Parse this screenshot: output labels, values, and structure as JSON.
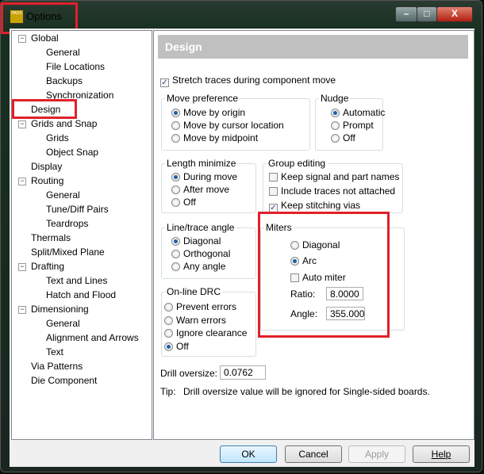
{
  "window": {
    "title": "Options",
    "icon_text": "PADS",
    "minimize": "–",
    "maximize": "□",
    "close": "X"
  },
  "tree": [
    {
      "label": "Global",
      "level": 0,
      "exp": "−"
    },
    {
      "label": "General",
      "level": 1
    },
    {
      "label": "File Locations",
      "level": 1
    },
    {
      "label": "Backups",
      "level": 1
    },
    {
      "label": "Synchronization",
      "level": 1
    },
    {
      "label": "Design",
      "level": 0,
      "selected": true
    },
    {
      "label": "Grids and Snap",
      "level": 0,
      "exp": "−"
    },
    {
      "label": "Grids",
      "level": 1
    },
    {
      "label": "Object Snap",
      "level": 1
    },
    {
      "label": "Display",
      "level": 0
    },
    {
      "label": "Routing",
      "level": 0,
      "exp": "−"
    },
    {
      "label": "General",
      "level": 1
    },
    {
      "label": "Tune/Diff Pairs",
      "level": 1
    },
    {
      "label": "Teardrops",
      "level": 1
    },
    {
      "label": "Thermals",
      "level": 0
    },
    {
      "label": "Split/Mixed Plane",
      "level": 0
    },
    {
      "label": "Drafting",
      "level": 0,
      "exp": "−"
    },
    {
      "label": "Text and Lines",
      "level": 1
    },
    {
      "label": "Hatch and Flood",
      "level": 1
    },
    {
      "label": "Dimensioning",
      "level": 0,
      "exp": "−"
    },
    {
      "label": "General",
      "level": 1
    },
    {
      "label": "Alignment and Arrows",
      "level": 1
    },
    {
      "label": "Text",
      "level": 1
    },
    {
      "label": "Via Patterns",
      "level": 0
    },
    {
      "label": "Die Component",
      "level": 0
    }
  ],
  "panel": {
    "header": "Design",
    "stretch": "Stretch traces during component move",
    "move_pref": {
      "legend": "Move preference",
      "opts": [
        "Move by origin",
        "Move by cursor location",
        "Move by midpoint"
      ]
    },
    "nudge": {
      "legend": "Nudge",
      "opts": [
        "Automatic",
        "Prompt",
        "Off"
      ]
    },
    "length": {
      "legend": "Length minimize",
      "opts": [
        "During move",
        "After move",
        "Off"
      ]
    },
    "group": {
      "legend": "Group editing",
      "opts": [
        "Keep signal and part names",
        "Include traces not attached",
        "Keep stitching vias"
      ]
    },
    "angle": {
      "legend": "Line/trace angle",
      "opts": [
        "Diagonal",
        "Orthogonal",
        "Any angle"
      ]
    },
    "drc": {
      "legend": "On-line DRC",
      "opts": [
        "Prevent errors",
        "Warn errors",
        "Ignore clearance",
        "Off"
      ]
    },
    "miters": {
      "legend": "Miters",
      "diagonal": "Diagonal",
      "arc": "Arc",
      "auto": "Auto miter",
      "ratio_label": "Ratio:",
      "ratio": "8.0000",
      "angle_label": "Angle:",
      "angle": "355.0000"
    },
    "drill_label": "Drill oversize:",
    "drill": "0.0762",
    "tip_label": "Tip:",
    "tip": "Drill oversize value will be ignored for Single-sided boards."
  },
  "buttons": {
    "ok": "OK",
    "cancel": "Cancel",
    "apply": "Apply",
    "help": "Help"
  }
}
